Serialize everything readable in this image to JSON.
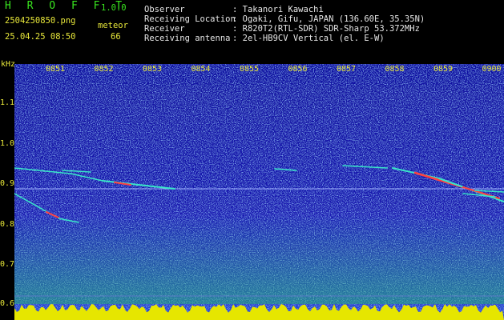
{
  "app": {
    "brand": "H R O F F T",
    "version": "1.0.0"
  },
  "file": {
    "name": "2504250850.png",
    "datetime": "25.04.25 08:50"
  },
  "meteor": {
    "label": "meteor",
    "count": "66"
  },
  "info": [
    {
      "key": "Observer",
      "value": ": Takanori Kawachi"
    },
    {
      "key": "Receiving Location",
      "value": ": Ogaki, Gifu, JAPAN (136.60E, 35.35N)"
    },
    {
      "key": "Receiver",
      "value": ": R820T2(RTL-SDR) SDR-Sharp 53.372MHz"
    },
    {
      "key": "Receiving antenna",
      "value": ": 2el-HB9CV Vertical (el. E-W)"
    }
  ],
  "axis": {
    "unit": "kHz",
    "y_ticks": [
      "1.1",
      "1.0",
      "0.9",
      "0.8",
      "0.7",
      "0.6"
    ],
    "x_ticks": [
      "0851",
      "0852",
      "0853",
      "0854",
      "0855",
      "0856",
      "0857",
      "0858",
      "0859",
      "0900"
    ]
  },
  "colors": {
    "background": "#1a1ab0",
    "noise": "#3a6cff",
    "signal": "#39e6c8",
    "echo": "#ff4040",
    "baseline": "#e6e600"
  }
}
